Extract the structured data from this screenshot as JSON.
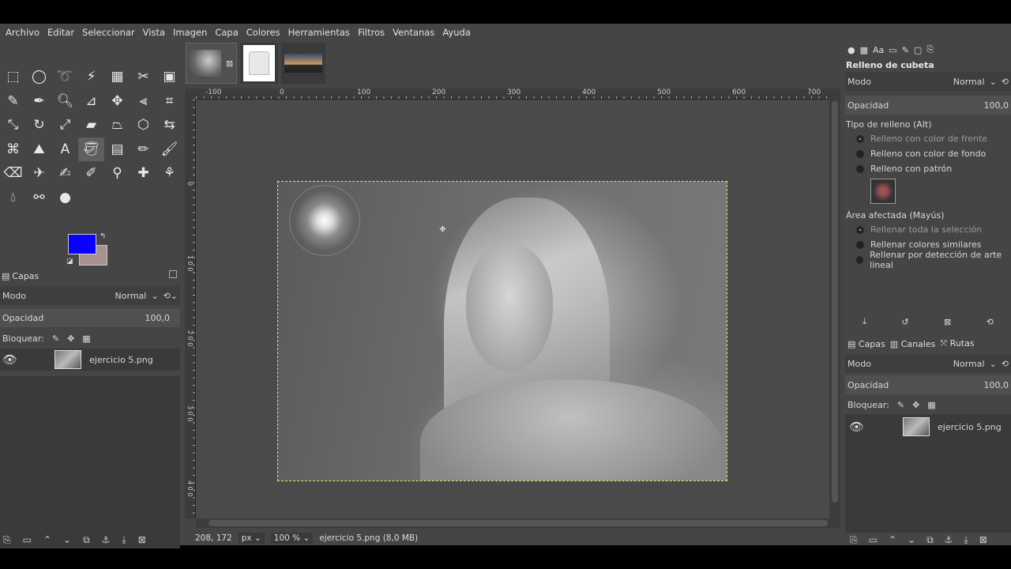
{
  "menu": [
    "Archivo",
    "Editar",
    "Seleccionar",
    "Vista",
    "Imagen",
    "Capa",
    "Colores",
    "Herramientas",
    "Filtros",
    "Ventanas",
    "Ayuda"
  ],
  "toolbox": {
    "tools": [
      "rect-select",
      "ellipse-select",
      "free-select",
      "fuzzy-select",
      "by-color-select",
      "scissors-select",
      "foreground-select",
      "paths",
      "color-picker",
      "zoom",
      "measure",
      "move",
      "align",
      "crop",
      "unified-transform",
      "rotate",
      "scale",
      "shear",
      "perspective",
      "3d-transform",
      "flip",
      "warp",
      "cage",
      "text",
      "bucket-fill",
      "gradient",
      "pencil",
      "paintbrush",
      "eraser",
      "airbrush",
      "ink",
      "mypaint-brush",
      "clone",
      "heal",
      "perspective-clone",
      "smudge",
      "dodge-burn",
      "blur"
    ],
    "active_tool": "bucket-fill",
    "foreground_color": "#0a00ff",
    "background_color": "#a8928f"
  },
  "left_layers": {
    "tab_label": "Capas",
    "mode_label": "Modo",
    "mode_value": "Normal",
    "opacity_label": "Opacidad",
    "opacity_value": "100,0",
    "lock_label": "Bloquear:",
    "layer_name": "ejercicio 5.png"
  },
  "image_tabs": [
    {
      "name": "portrait",
      "active": true
    },
    {
      "name": "shirt",
      "active": false
    },
    {
      "name": "sunset",
      "active": false
    }
  ],
  "rulers": {
    "h_ticks": [
      "-100",
      "0",
      "100",
      "200",
      "300",
      "400",
      "500",
      "600",
      "700"
    ],
    "v_ticks": [
      "0",
      "1 0 0",
      "2 0 0",
      "3 0 0",
      "4 0 0"
    ]
  },
  "status": {
    "coords": "208, 172",
    "unit": "px",
    "zoom": "100 %",
    "file_info": "ejercicio 5.png (8,0 MB)"
  },
  "tool_options": {
    "title": "Relleno de cubeta",
    "mode_label": "Modo",
    "mode_value": "Normal",
    "opacity_label": "Opacidad",
    "opacity_value": "100,0",
    "fill_type_label": "Tipo de relleno  (Alt)",
    "fill_types": [
      "Relleno con color de frente",
      "Relleno con color de fondo",
      "Relleno con patrón"
    ],
    "area_label": "Área afectada  (Mayús)",
    "areas": [
      "Rellenar toda la selección",
      "Rellenar colores similares",
      "Rellenar por detección de arte lineal"
    ]
  },
  "right_layers": {
    "tabs": [
      "Capas",
      "Canales",
      "Rutas"
    ],
    "mode_label": "Modo",
    "mode_value": "Normal",
    "opacity_label": "Opacidad",
    "opacity_value": "100,0",
    "lock_label": "Bloquear:",
    "layer_name": "ejercicio 5.png"
  }
}
